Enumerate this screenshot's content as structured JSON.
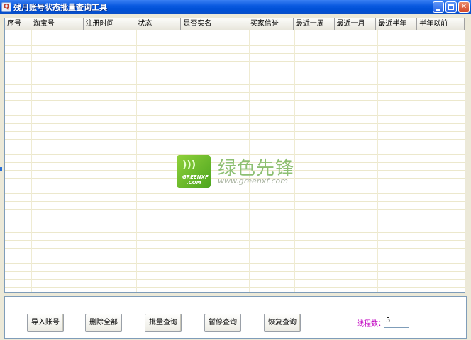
{
  "window": {
    "title": "残月账号状态批量查询工具",
    "icon": "app-icon",
    "buttons": [
      "minimize-icon",
      "maximize-icon",
      "close-icon"
    ]
  },
  "table": {
    "columns": [
      "序号",
      "淘宝号",
      "注册时间",
      "状态",
      "是否实名",
      "买家信誉",
      "最近一周",
      "最近一月",
      "最近半年",
      "半年以前"
    ],
    "rows": []
  },
  "watermark": {
    "logo_text_1": "GREENXF",
    "logo_text_2": ".COM",
    "chinese": "绿色先锋",
    "url": "www.greenxf.com"
  },
  "actions": {
    "import": "导入账号",
    "delete_all": "删除全部",
    "batch_query": "批量查询",
    "pause_query": "暂停查询",
    "resume_query": "恢复查询"
  },
  "threads": {
    "label": "线程数：",
    "value": "5"
  },
  "colors": {
    "titlebar": "#0a5ae0",
    "thread_label": "#c000c0"
  }
}
